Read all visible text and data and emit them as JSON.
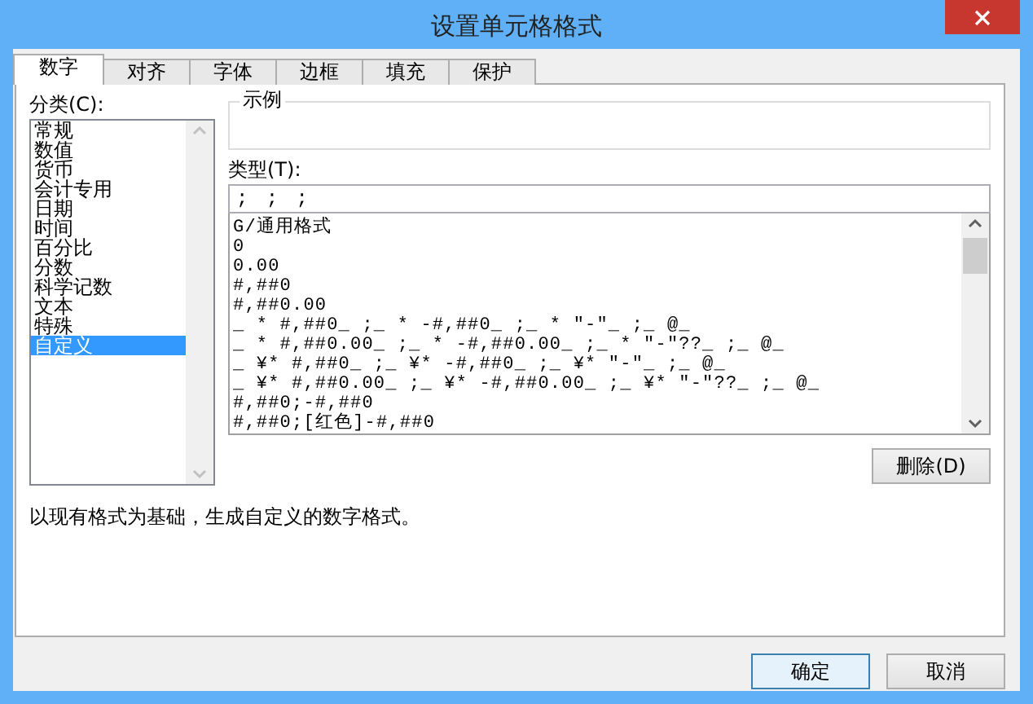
{
  "window": {
    "title": "设置单元格格式"
  },
  "tabs": [
    {
      "label": "数字",
      "selected": true
    },
    {
      "label": "对齐",
      "selected": false
    },
    {
      "label": "字体",
      "selected": false
    },
    {
      "label": "边框",
      "selected": false
    },
    {
      "label": "填充",
      "selected": false
    },
    {
      "label": "保护",
      "selected": false
    }
  ],
  "category": {
    "label": "分类(C):",
    "items": [
      {
        "label": "常规",
        "selected": false
      },
      {
        "label": "数值",
        "selected": false
      },
      {
        "label": "货币",
        "selected": false
      },
      {
        "label": "会计专用",
        "selected": false
      },
      {
        "label": "日期",
        "selected": false
      },
      {
        "label": "时间",
        "selected": false
      },
      {
        "label": "百分比",
        "selected": false
      },
      {
        "label": "分数",
        "selected": false
      },
      {
        "label": "科学记数",
        "selected": false
      },
      {
        "label": "文本",
        "selected": false
      },
      {
        "label": "特殊",
        "selected": false
      },
      {
        "label": "自定义",
        "selected": true
      }
    ]
  },
  "sample": {
    "label": "示例"
  },
  "type": {
    "label": "类型(T):",
    "value": "; ; ;",
    "formats": [
      "G/通用格式",
      "0",
      "0.00",
      "#,##0",
      "#,##0.00",
      "_ * #,##0_ ;_ * -#,##0_ ;_ * \"-\"_ ;_ @_",
      "_ * #,##0.00_ ;_ * -#,##0.00_ ;_ * \"-\"??_ ;_ @_",
      "_ ¥* #,##0_ ;_ ¥* -#,##0_ ;_ ¥* \"-\"_ ;_ @_",
      "_ ¥* #,##0.00_ ;_ ¥* -#,##0.00_ ;_ ¥* \"-\"??_ ;_ @_",
      "#,##0;-#,##0",
      "#,##0;[红色]-#,##0"
    ]
  },
  "delete_button": "删除(D)",
  "description": "以现有格式为基础，生成自定义的数字格式。",
  "buttons": [
    {
      "label": "确定",
      "default": true
    },
    {
      "label": "取消",
      "default": false
    }
  ]
}
